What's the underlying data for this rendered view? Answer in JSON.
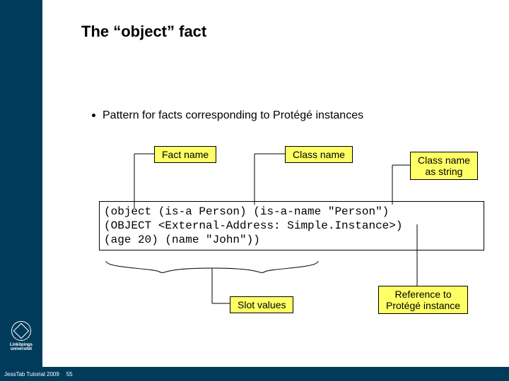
{
  "title": "The “object” fact",
  "bullet": "Pattern for facts corresponding to Protégé instances",
  "labels": {
    "fact_name": "Fact name",
    "class_name": "Class name",
    "class_name_as_string": "Class name\nas string",
    "slot_values": "Slot values",
    "reference": "Reference to\nProtégé instance"
  },
  "code": {
    "l1": "(object (is-a Person) (is-a-name \"Person\")",
    "l2": "(OBJECT <External-Address: Simple.Instance>)",
    "l3": "(age 20) (name \"John\"))"
  },
  "branding": {
    "university": "Linköpings universitet"
  },
  "footer": {
    "source": "JessTab Tutorial 2009",
    "page": "55"
  }
}
